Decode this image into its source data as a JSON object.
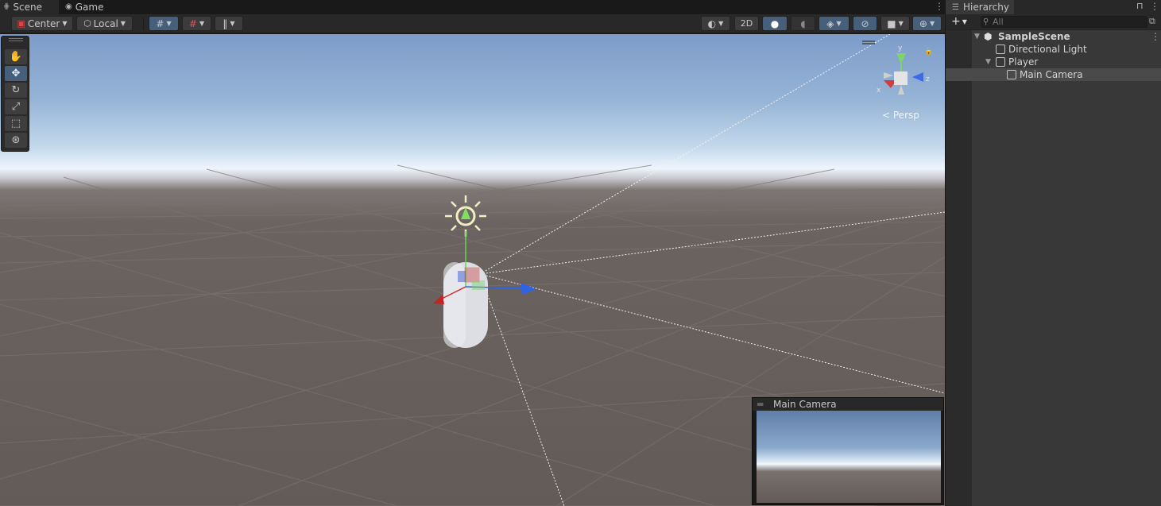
{
  "tabs": {
    "scene": "Scene",
    "game": "Game"
  },
  "scene_toolbar": {
    "pivot_mode": "Center",
    "pivot_rotation": "Local",
    "mode_2d": "2D",
    "view_mode": "Persp"
  },
  "camera_preview": {
    "title": "Main Camera"
  },
  "gizmo_axes": {
    "y": "y",
    "x": "x",
    "z": "z"
  },
  "hierarchy": {
    "title": "Hierarchy",
    "add_label": "+",
    "search_placeholder": "All",
    "items": [
      {
        "label": "SampleScene",
        "depth": 0,
        "bold": true,
        "expanded": true
      },
      {
        "label": "Directional Light",
        "depth": 1,
        "expanded": false
      },
      {
        "label": "Player",
        "depth": 1,
        "expanded": true
      },
      {
        "label": "Main Camera",
        "depth": 2,
        "selected": true
      }
    ]
  },
  "colors": {
    "panel_dark": "#191919",
    "panel": "#282828",
    "button": "#3c3c3c",
    "active_blue": "#46607c",
    "axis_x": "#d22a2a",
    "axis_y": "#6ad35b",
    "axis_z": "#2e63e6"
  }
}
